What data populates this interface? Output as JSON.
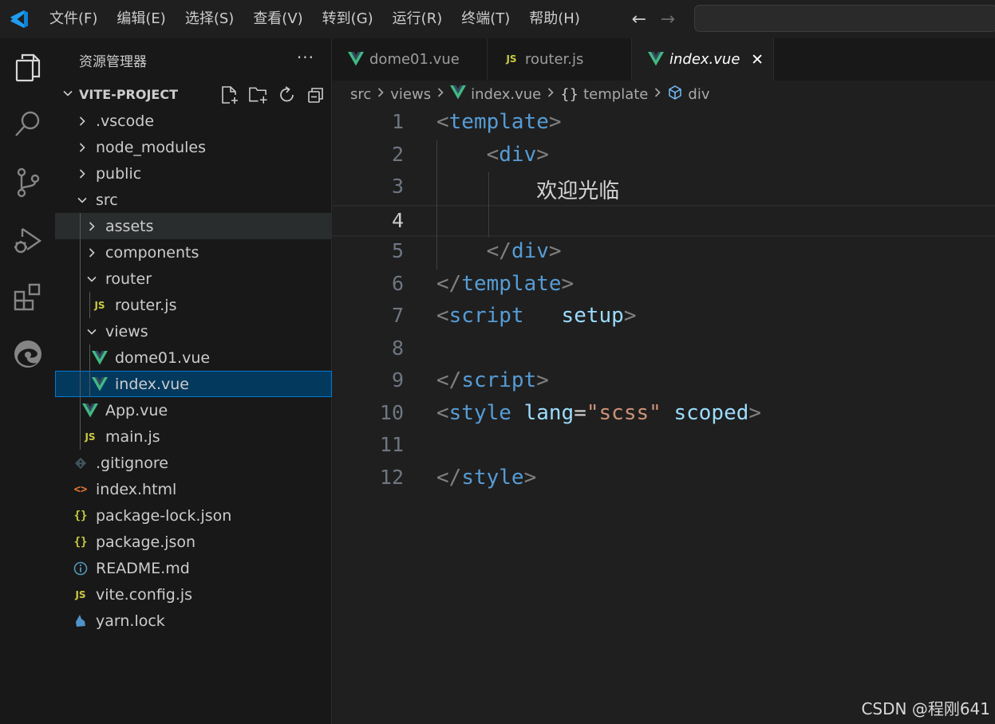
{
  "menu": [
    "文件(F)",
    "编辑(E)",
    "选择(S)",
    "查看(V)",
    "转到(G)",
    "运行(R)",
    "终端(T)",
    "帮助(H)"
  ],
  "nav": {
    "back": "←",
    "forward": "→"
  },
  "activity_bar": [
    "explorer-icon",
    "search-icon",
    "source-control-icon",
    "run-debug-icon",
    "extensions-icon",
    "edge-devtools-icon"
  ],
  "sidebar": {
    "title": "资源管理器",
    "more": "···",
    "project": "VITE-PROJECT",
    "tree": [
      {
        "label": ".vscode",
        "depth": 0,
        "kind": "folder",
        "open": false
      },
      {
        "label": "node_modules",
        "depth": 0,
        "kind": "folder",
        "open": false
      },
      {
        "label": "public",
        "depth": 0,
        "kind": "folder",
        "open": false
      },
      {
        "label": "src",
        "depth": 0,
        "kind": "folder",
        "open": true
      },
      {
        "label": "assets",
        "depth": 1,
        "kind": "folder",
        "open": false,
        "state": "hover"
      },
      {
        "label": "components",
        "depth": 1,
        "kind": "folder",
        "open": false
      },
      {
        "label": "router",
        "depth": 1,
        "kind": "folder",
        "open": true
      },
      {
        "label": "router.js",
        "depth": 2,
        "kind": "js"
      },
      {
        "label": "views",
        "depth": 1,
        "kind": "folder",
        "open": true
      },
      {
        "label": "dome01.vue",
        "depth": 2,
        "kind": "vue"
      },
      {
        "label": "index.vue",
        "depth": 2,
        "kind": "vue",
        "state": "selected"
      },
      {
        "label": "App.vue",
        "depth": 1,
        "kind": "vue"
      },
      {
        "label": "main.js",
        "depth": 1,
        "kind": "js"
      },
      {
        "label": ".gitignore",
        "depth": 0,
        "kind": "git"
      },
      {
        "label": "index.html",
        "depth": 0,
        "kind": "html"
      },
      {
        "label": "package-lock.json",
        "depth": 0,
        "kind": "json"
      },
      {
        "label": "package.json",
        "depth": 0,
        "kind": "json"
      },
      {
        "label": "README.md",
        "depth": 0,
        "kind": "info"
      },
      {
        "label": "vite.config.js",
        "depth": 0,
        "kind": "js"
      },
      {
        "label": "yarn.lock",
        "depth": 0,
        "kind": "yarn"
      }
    ]
  },
  "tabs": [
    {
      "label": "dome01.vue",
      "kind": "vue",
      "active": false
    },
    {
      "label": "router.js",
      "kind": "js",
      "active": false
    },
    {
      "label": "index.vue",
      "kind": "vue",
      "active": true
    }
  ],
  "tab_close": "✕",
  "breadcrumb": [
    "src",
    "views",
    "index.vue",
    "template",
    "div"
  ],
  "editor": {
    "current_line": 4,
    "lines": [
      [
        [
          "p",
          "<"
        ],
        [
          "tag",
          "template"
        ],
        [
          "p",
          ">"
        ]
      ],
      [
        [
          "t",
          "    "
        ],
        [
          "p",
          "<"
        ],
        [
          "tag",
          "div"
        ],
        [
          "p",
          ">"
        ]
      ],
      [
        [
          "t",
          "        欢迎光临"
        ]
      ],
      [],
      [
        [
          "t",
          "    "
        ],
        [
          "p",
          "</"
        ],
        [
          "tag",
          "div"
        ],
        [
          "p",
          ">"
        ]
      ],
      [
        [
          "p",
          "</"
        ],
        [
          "tag",
          "template"
        ],
        [
          "p",
          ">"
        ]
      ],
      [
        [
          "p",
          "<"
        ],
        [
          "tag",
          "script"
        ],
        [
          "t",
          "   "
        ],
        [
          "attr",
          "setup"
        ],
        [
          "p",
          ">"
        ]
      ],
      [],
      [
        [
          "p",
          "</"
        ],
        [
          "tag",
          "script"
        ],
        [
          "p",
          ">"
        ]
      ],
      [
        [
          "p",
          "<"
        ],
        [
          "tag",
          "style"
        ],
        [
          "t",
          " "
        ],
        [
          "attr",
          "lang"
        ],
        [
          "t",
          "="
        ],
        [
          "str",
          "\"scss\""
        ],
        [
          "t",
          " "
        ],
        [
          "attr",
          "scoped"
        ],
        [
          "p",
          ">"
        ]
      ],
      [],
      [
        [
          "p",
          "</"
        ],
        [
          "tag",
          "style"
        ],
        [
          "p",
          ">"
        ]
      ]
    ]
  },
  "watermark": "CSDN @程刚641",
  "colors": {
    "accent": "#0078d4",
    "vue": "#41b883",
    "js": "#cbcb41",
    "tag": "#569cd6",
    "attr": "#9cdcfe",
    "string": "#ce9178"
  }
}
